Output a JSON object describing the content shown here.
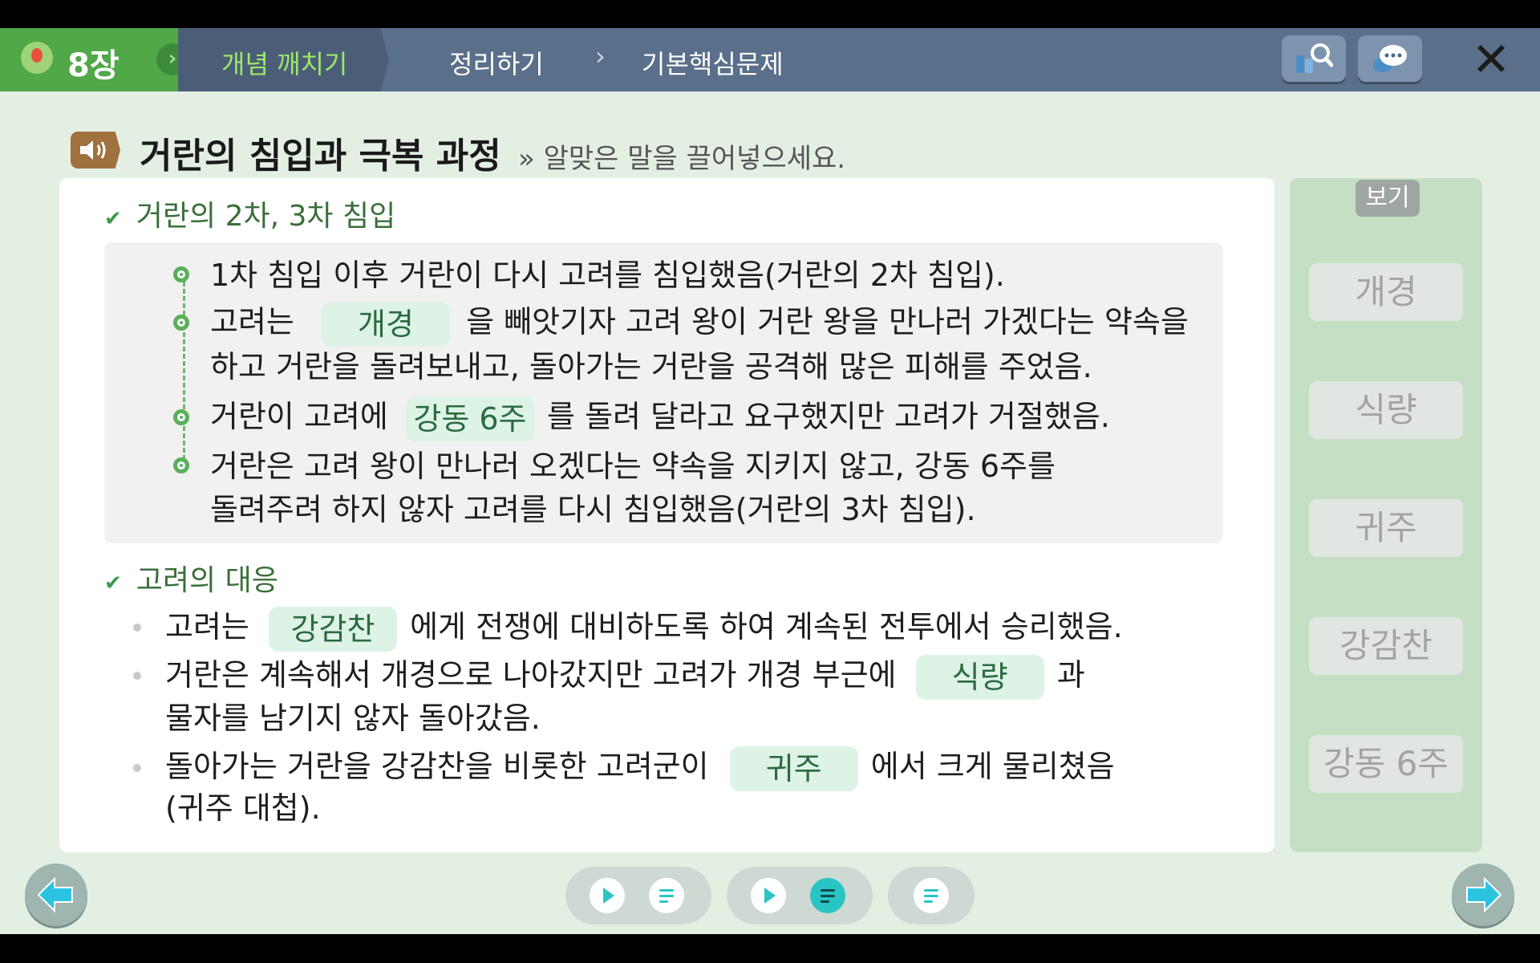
{
  "topbar": {
    "chapter": "8장",
    "tabs": [
      "개념 깨치기",
      "정리하기",
      "기본핵심문제"
    ],
    "separator": "›"
  },
  "title": "거란의 침입과 극복 과정",
  "instruction": "» 알맞은 말을 끌어넣으세요.",
  "section1": {
    "heading": "거란의 2차, 3차 침입",
    "lines": [
      "1차 침입 이후 거란이 다시 고려를 침입했음(거란의 2차 침입).",
      "고려는",
      "개경",
      "을 빼앗기자 고려 왕이 거란 왕을 만나러 가겠다는 약속을",
      "하고 거란을 돌려보내고, 돌아가는 거란을 공격해 많은 피해를 주었음.",
      "거란이 고려에",
      "강동 6주",
      "를 돌려 달라고 요구했지만 고려가 거절했음.",
      "거란은 고려 왕이 만나러 오겠다는 약속을 지키지 않고, 강동 6주를",
      "돌려주려 하지 않자 고려를 다시 침입했음(거란의 3차 침입)."
    ]
  },
  "section2": {
    "heading": "고려의 대응",
    "lines": [
      "고려는",
      "강감찬",
      "에게 전쟁에 대비하도록 하여 계속된 전투에서 승리했음.",
      "거란은 계속해서 개경으로 나아갔지만 고려가 개경 부근에",
      "식량",
      "과",
      "물자를 남기지 않자 돌아갔음.",
      "돌아가는 거란을 강감찬을 비롯한 고려군이",
      "귀주",
      "에서 크게 물리쳤음",
      "(귀주 대첩)."
    ]
  },
  "sidebar": {
    "label": "보기",
    "chips": [
      "개경",
      "식량",
      "귀주",
      "강감찬",
      "강동 6주"
    ]
  },
  "icons": {
    "search": "book-search-icon",
    "chat": "chat-bubble-icon",
    "close": "close-icon",
    "sound": "speaker-icon"
  },
  "colors": {
    "accent": "#50a848",
    "answer_bg": "#ddf3e6",
    "active_control": "#2bc4c4"
  }
}
